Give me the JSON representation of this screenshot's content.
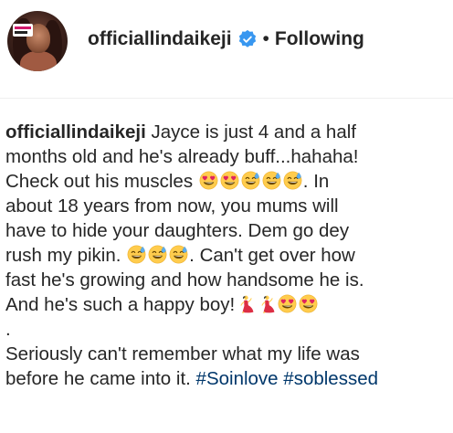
{
  "post": {
    "header": {
      "username": "officiallindaikeji",
      "separator": "•",
      "follow_status": "Following"
    },
    "caption": {
      "author": "officiallindaikeji",
      "lines": [
        " Jayce is just 4 and a half",
        "months old and he's already buff...hahaha!",
        "Check out his muscles",
        ". In",
        "about 18 years from now, you mums will",
        "have to hide your daughters. Dem go dey",
        "rush my pikin.",
        ". Can't get over how",
        "fast he's growing and how handsome he is.",
        "And he's such a happy boy!",
        ".",
        "Seriously can't remember what my life was",
        "before he came into it. "
      ],
      "hashtags": [
        "#Soinlove",
        "#soblessed"
      ]
    },
    "icons": {
      "verified": "verified-badge-icon",
      "heart_eyes": "heart-eyes-emoji",
      "sweat_smile": "sweat-smile-emoji",
      "dancer": "dancer-emoji"
    },
    "colors": {
      "text": "#262626",
      "verified_blue": "#3897f0",
      "hashtag": "#00376b",
      "divider": "#efefef"
    }
  }
}
